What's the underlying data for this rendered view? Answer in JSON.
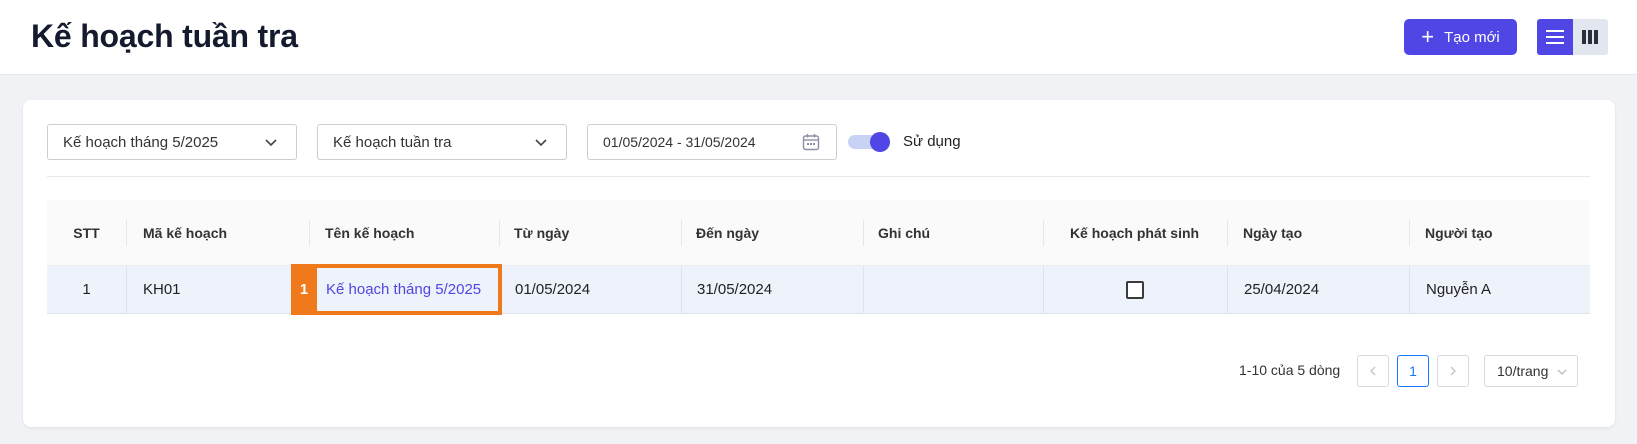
{
  "header": {
    "title": "Kế hoạch tuần tra",
    "new_button_label": "Tạo mới"
  },
  "filters": {
    "plan_select_value": "Kế hoạch tháng 5/2025",
    "type_select_value": "Kế hoạch tuần tra",
    "date_range_value": "01/05/2024 - 31/05/2024",
    "active_toggle_label": "Sử dụng",
    "active_toggle_on": true
  },
  "table": {
    "columns": [
      "STT",
      "Mã kế hoạch",
      "Tên kế hoạch",
      "Từ ngày",
      "Đến ngày",
      "Ghi chú",
      "Kế hoạch phát sinh",
      "Ngày tạo",
      "Người tạo"
    ],
    "rows": [
      {
        "stt": "1",
        "code": "KH01",
        "name": "Kế hoạch tháng 5/2025",
        "from": "01/05/2024",
        "to": "31/05/2024",
        "note": "",
        "incurred": false,
        "created": "25/04/2024",
        "creator": "Nguyễn A"
      }
    ]
  },
  "annotation": {
    "marker_number": "1"
  },
  "pagination": {
    "info": "1-10 của 5 dòng",
    "current_page": "1",
    "page_size": "10/trang"
  },
  "colors": {
    "accent": "#5046e5",
    "highlight": "#f07a1b",
    "row_bg": "#eef2fb"
  }
}
